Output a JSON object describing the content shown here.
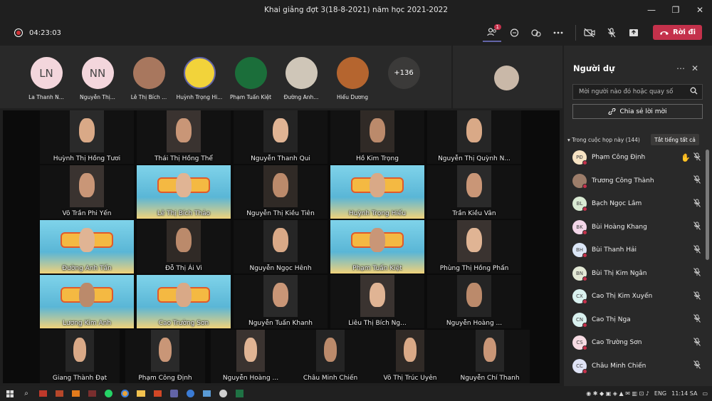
{
  "window": {
    "title": "Khai giảng đợt 3(18-8-2021) năm học 2021-2022",
    "minimize": "—",
    "restore": "❐",
    "close": "✕"
  },
  "toolbar": {
    "timer": "04:23:03",
    "participants_badge": "1",
    "leave_label": "Rời đi",
    "icons": [
      "participants-icon",
      "chat-icon",
      "reactions-icon",
      "more-icon",
      "camera-off-icon",
      "mic-off-icon",
      "share-screen-icon"
    ]
  },
  "attendees": [
    {
      "initials": "LN",
      "name": "La Thanh N...",
      "color": "#f3d6dc"
    },
    {
      "initials": "NN",
      "name": "Nguyễn Thị...",
      "color": "#f3d6dc"
    },
    {
      "initials": "",
      "name": "Lê Thị Bích ...",
      "color": "#a8775e"
    },
    {
      "initials": "",
      "name": "Huỳnh Trọng Hi...",
      "color": "#f2d33a"
    },
    {
      "initials": "",
      "name": "Phạm Tuấn Kiệt",
      "color": "#1b6e3a"
    },
    {
      "initials": "",
      "name": "Đường Anh...",
      "color": "#cfc6b8"
    },
    {
      "initials": "",
      "name": "Hiếu Dương",
      "color": "#b5652f"
    }
  ],
  "more_count": "+136",
  "tiles": [
    "Huỳnh Thị Hồng Tươi",
    "Thái Thị Hồng Thể",
    "Nguyễn Thanh Qui",
    "Hồ Kim Trọng",
    "Nguyễn Thị Quỳnh N...",
    "Võ Trần Phi Yến",
    "Lê Thị Bích Thảo",
    "Nguyễn Thị Kiều Tiên",
    "Huỳnh Trọng Hiếu",
    "Trần Kiều Vân",
    "Đường Anh Tấn",
    "Đỗ Thị Ái Vi",
    "Nguyễn Ngọc Hênh",
    "Phạm Tuấn Kiệt",
    "Phùng Thị Hồng Phấn",
    "Lương Kim Anh",
    "Cao Trường Sơn",
    "Nguyễn Tuấn Khanh",
    "Liêu Thị Bích Ng...",
    "Nguyễn Hoàng ...",
    "Giang Thành Đạt",
    "Phạm Công Định",
    "Nguyễn Hoàng ...",
    "Châu Minh Chiến",
    "Võ Thị Trúc Uyên",
    "Nguyễn Chí Thanh"
  ],
  "panel": {
    "title": "Người dự",
    "search_placeholder": "Mời người nào đó hoặc quay số",
    "share_label": "Chia sẻ lời mời",
    "section_label": "Trong cuộc họp này (144)",
    "mute_all": "Tắt tiếng tất cả",
    "people": [
      {
        "initials": "PĐ",
        "name": "Phạm Công Định",
        "color": "#f7e3c3",
        "hand": true
      },
      {
        "initials": "",
        "name": "Trương Công Thành",
        "color": "#9c7d6a",
        "hand": false
      },
      {
        "initials": "BL",
        "name": "Bạch Ngọc Lâm",
        "color": "#d9ead3",
        "hand": false
      },
      {
        "initials": "BK",
        "name": "Bùi Hoàng Khang",
        "color": "#f3d6e8",
        "hand": false
      },
      {
        "initials": "BH",
        "name": "Bùi Thanh Hải",
        "color": "#dbe6f6",
        "hand": false
      },
      {
        "initials": "BN",
        "name": "Bùi Thị Kim Ngân",
        "color": "#e3e9d6",
        "hand": false
      },
      {
        "initials": "CX",
        "name": "Cao Thị Kim Xuyến",
        "color": "#d9f1ef",
        "hand": false
      },
      {
        "initials": "CN",
        "name": "Cao Thị Nga",
        "color": "#d9f1ef",
        "hand": false
      },
      {
        "initials": "CS",
        "name": "Cao Trường Sơn",
        "color": "#f6dbe3",
        "hand": false
      },
      {
        "initials": "CC",
        "name": "Châu Minh Chiến",
        "color": "#dfe3f6",
        "hand": false
      }
    ]
  },
  "taskbar": {
    "lang": "ENG",
    "time": "11:14 SA"
  }
}
